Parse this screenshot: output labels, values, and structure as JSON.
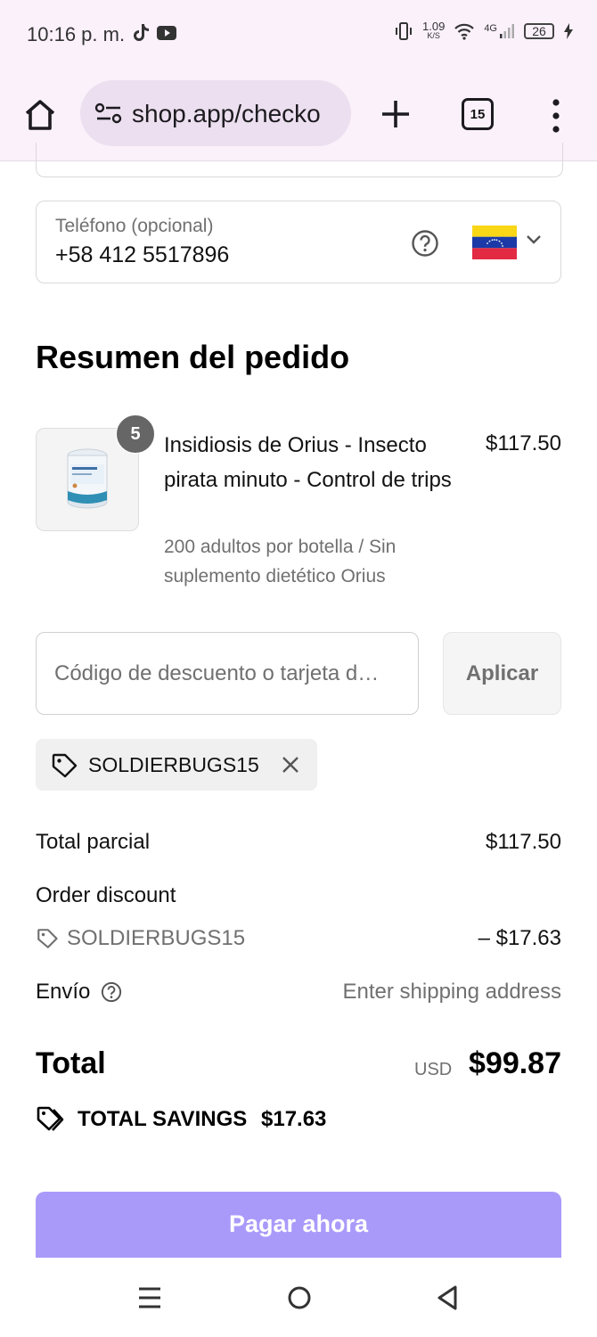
{
  "status_bar": {
    "time": "10:16 p. m.",
    "app_icons": [
      "tiktok-icon",
      "youtube-icon"
    ],
    "net_speed_value": "1.09",
    "net_speed_unit": "K/S",
    "network": "4G",
    "battery": "26"
  },
  "browser": {
    "url": "shop.app/checko",
    "tab_count": "15",
    "icons": [
      "home-icon",
      "site-settings-icon",
      "plus-icon",
      "tab-switcher-icon",
      "kebab-menu-icon"
    ]
  },
  "phone": {
    "label": "Teléfono (opcional)",
    "value": "+58 412 5517896",
    "country_flag": "venezuela-flag-icon"
  },
  "summary": {
    "title": "Resumen del pedido",
    "item": {
      "quantity": "5",
      "name": "Insidiosis de Orius - Insecto pirata minuto - Control de trips",
      "variant": "200 adultos por botella / Sin suplemento dietético Orius",
      "price": "$117.50"
    },
    "discount": {
      "placeholder": "Código de descuento o tarjeta d…",
      "apply_label": "Aplicar",
      "applied_code": "SOLDIERBUGS15"
    },
    "totals": {
      "subtotal_label": "Total parcial",
      "subtotal_value": "$117.50",
      "order_discount_label": "Order discount",
      "discount_code": "SOLDIERBUGS15",
      "discount_value": "– $17.63",
      "shipping_label": "Envío",
      "shipping_value": "Enter shipping address",
      "total_label": "Total",
      "currency": "USD",
      "total_value": "$99.87",
      "savings_label": "TOTAL SAVINGS",
      "savings_value": "$17.63"
    },
    "pay_label": "Pagar ahora"
  },
  "colors": {
    "browser_chrome": "#fbf1fb",
    "url_pill": "#ecdfef",
    "pay_button": "#a99afa",
    "muted_text": "#707070"
  },
  "nav_bar": {
    "icons": [
      "recent-apps-icon",
      "home-circle-icon",
      "back-triangle-icon"
    ]
  }
}
